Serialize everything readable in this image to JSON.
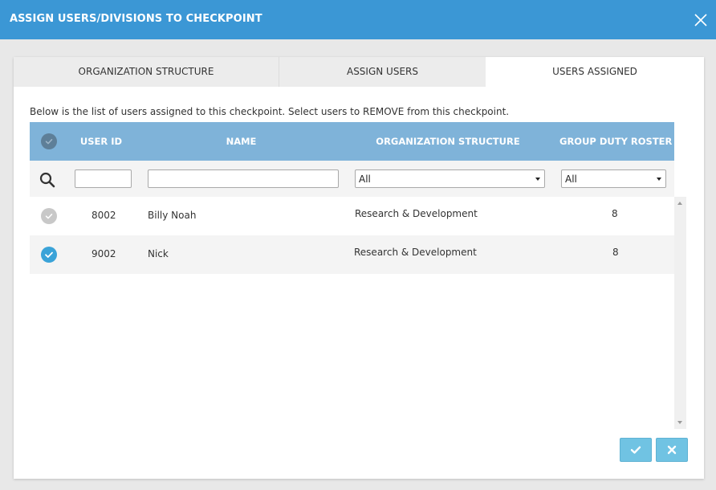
{
  "dialog": {
    "title": "ASSIGN USERS/DIVISIONS TO CHECKPOINT"
  },
  "tabs": [
    {
      "label": "ORGANIZATION STRUCTURE",
      "active": false
    },
    {
      "label": "ASSIGN USERS",
      "active": false
    },
    {
      "label": "USERS ASSIGNED",
      "active": true
    }
  ],
  "description": "Below is the list of users assigned to this checkpoint. Select users to REMOVE from this checkpoint.",
  "table": {
    "columns": [
      "USER ID",
      "NAME",
      "ORGANIZATION STRUCTURE",
      "GROUP DUTY ROSTER"
    ],
    "filters": {
      "user_id": "",
      "name": "",
      "org_structure": "All",
      "group_duty_roster": "All"
    },
    "rows": [
      {
        "checked": false,
        "user_id": "8002",
        "name": "Billy Noah",
        "org": "Research & Development",
        "roster": "8"
      },
      {
        "checked": true,
        "user_id": "9002",
        "name": "Nick",
        "org": "Research & Development",
        "roster": "8"
      }
    ]
  },
  "buttons": {
    "confirm_icon": "check-icon",
    "cancel_icon": "times-icon"
  },
  "colors": {
    "titlebar": "#3b97d5",
    "table_header": "#7fb3d9",
    "checked": "#3aa3d8",
    "button": "#70c3e3"
  }
}
